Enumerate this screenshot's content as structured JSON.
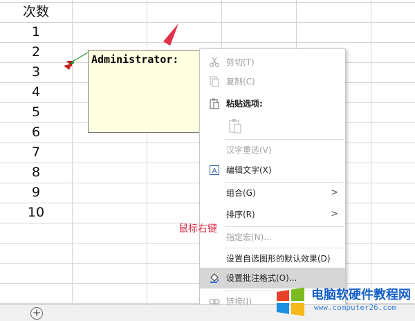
{
  "sheet": {
    "header": "次数",
    "rows": [
      "1",
      "2",
      "3",
      "4",
      "5",
      "6",
      "7",
      "8",
      "9",
      "10"
    ]
  },
  "comment": {
    "author": "Administrator:"
  },
  "menu": {
    "cut": "剪切(T)",
    "copy": "复制(C)",
    "paste_options": "粘贴选项:",
    "reselect": "汉字重选(V)",
    "edit_text": "编辑文字(X)",
    "group": "组合(G)",
    "order": "排序(R)",
    "assign_macro": "指定宏(N)...",
    "set_default": "设置自选图形的默认效果(D)",
    "format_comment": "设置批注格式(O)...",
    "link": "链接(I)"
  },
  "annotation": "鼠标右键",
  "watermark": {
    "title": "电脑软硬件教程网",
    "url": "www.computer26.com"
  },
  "colors": {
    "annotation_red": "#e0304a",
    "comment_bg": "#ffffe1",
    "hover_bg": "#d6d6d6"
  }
}
